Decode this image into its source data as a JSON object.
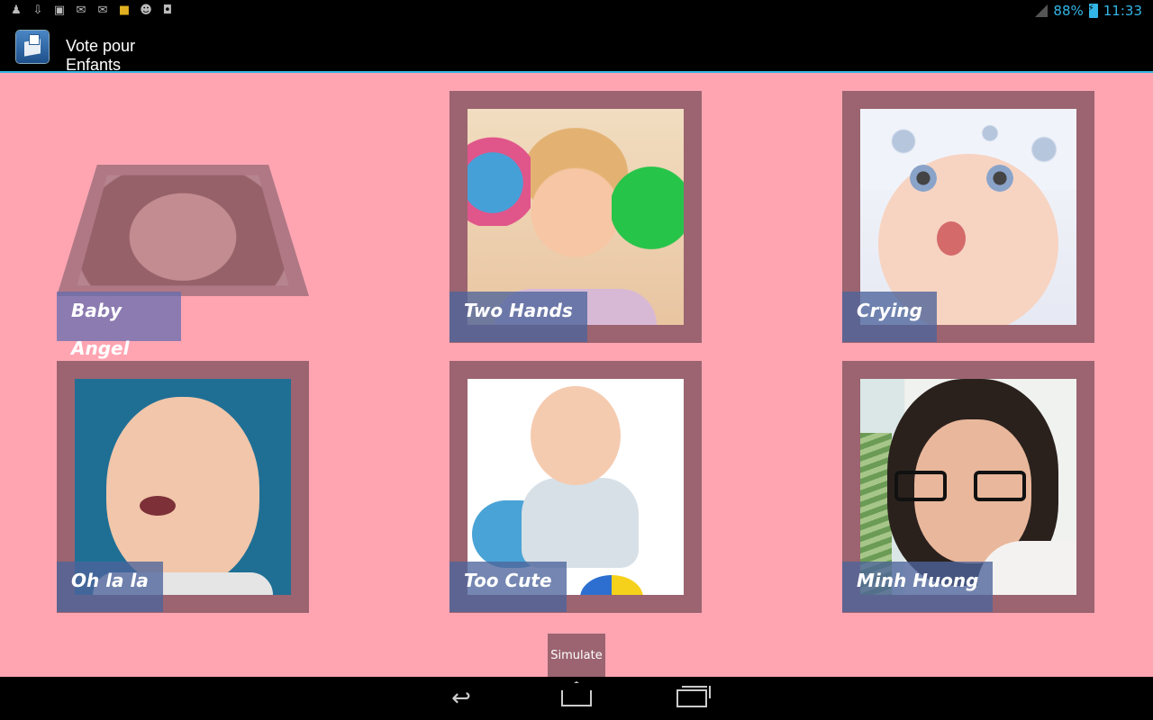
{
  "status_bar": {
    "icons": [
      "usb-debug-icon",
      "download-icon",
      "gallery-icon",
      "gmail-icon",
      "email-icon",
      "app-notification-icon",
      "android-icon",
      "store-icon"
    ],
    "battery": "88%",
    "time": "11:33",
    "accent": "#33b5e5"
  },
  "action_bar": {
    "title": "Vote pour Enfants",
    "logo": "ballot-box-icon"
  },
  "content": {
    "background": "#ffa5b2",
    "card_color": "#9b6470",
    "caption_color": "#4d649b",
    "cards": [
      {
        "label": "Baby Angel"
      },
      {
        "label": "Two Hands"
      },
      {
        "label": "Crying"
      },
      {
        "label": "Oh la la"
      },
      {
        "label": "Too Cute"
      },
      {
        "label": "Minh Huong"
      }
    ],
    "simulate_label": "Simulate"
  },
  "nav_bar": {
    "buttons": [
      "back-icon",
      "home-icon",
      "recent-apps-icon"
    ]
  }
}
